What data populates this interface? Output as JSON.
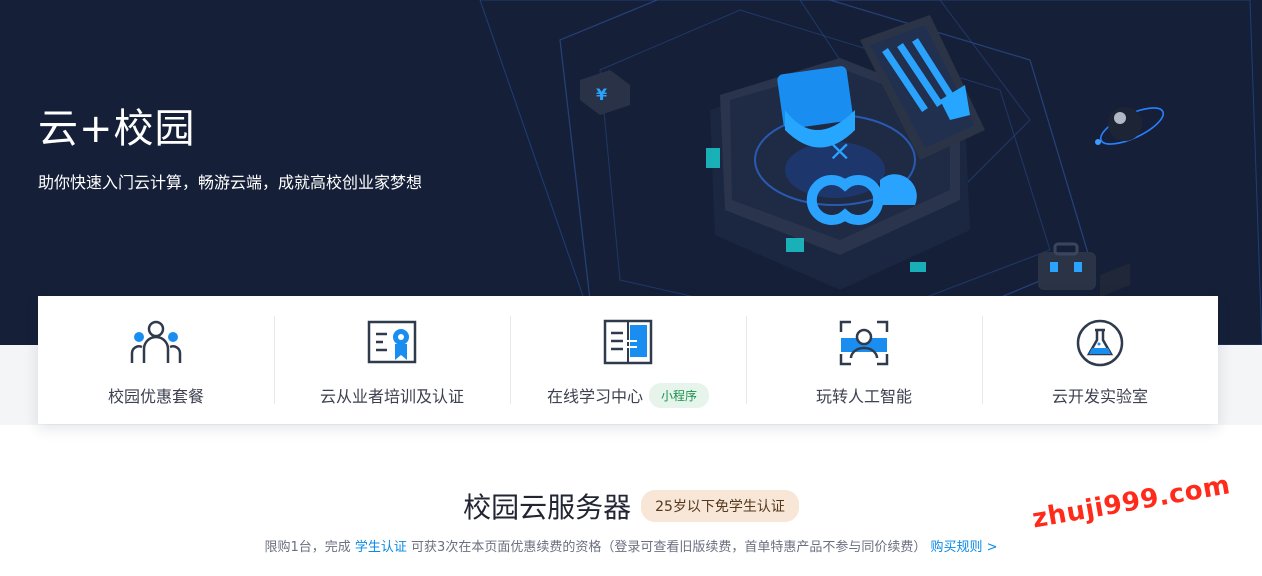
{
  "hero": {
    "title": "云+校园",
    "subtitle": "助你快速入门云计算，畅游云端，成就高校创业家梦想"
  },
  "cards": [
    {
      "label": "校园优惠套餐",
      "icon": "people-group-icon"
    },
    {
      "label": "云从业者培训及认证",
      "icon": "certificate-icon"
    },
    {
      "label": "在线学习中心",
      "icon": "book-icon",
      "badge": "小程序"
    },
    {
      "label": "玩转人工智能",
      "icon": "face-scan-icon"
    },
    {
      "label": "云开发实验室",
      "icon": "flask-icon"
    }
  ],
  "section": {
    "title": "校园云服务器",
    "badge": "25岁以下免学生认证",
    "note_prefix": "限购1台，完成 ",
    "note_link": "学生认证",
    "note_middle": " 可获3次在本页面优惠续费的资格（登录可查看旧版续费，首单特惠产品不参与同价续费） ",
    "note_rule_link": "购买规则 >"
  },
  "watermark": "zhuji999.com",
  "colors": {
    "hero_bg": "#152038",
    "accent_blue": "#1a8ef0",
    "badge_green_bg": "#e6f4ec",
    "badge_orange_bg": "#f8e6d7",
    "link": "#0a8ae6",
    "watermark": "#ff2a1a"
  }
}
